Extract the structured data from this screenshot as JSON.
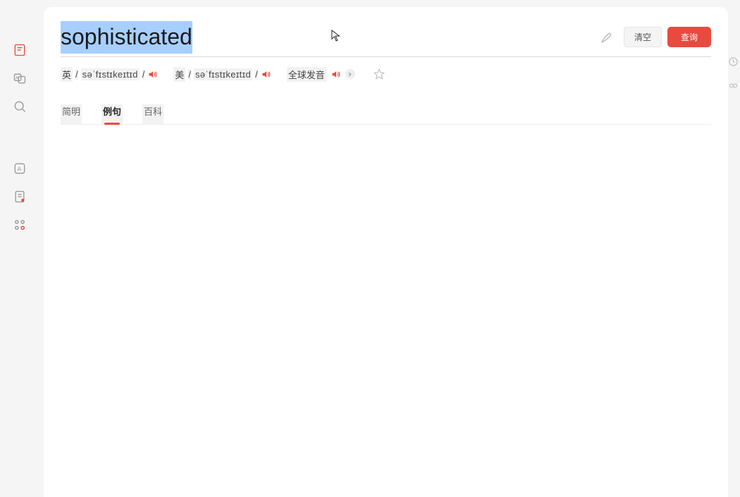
{
  "search": {
    "word": "sophisticated",
    "clear_label": "清空",
    "query_label": "查询"
  },
  "phonetics": {
    "uk_label": "英",
    "uk_ipa": "səˈfɪstɪkeɪtɪd",
    "us_label": "美",
    "us_ipa": "səˈfɪstɪkeɪtɪd",
    "global_label": "全球发音"
  },
  "tabs": [
    {
      "label": "简明"
    },
    {
      "label": "例句"
    },
    {
      "label": "百科"
    }
  ],
  "sidebar": {
    "items": [
      "dictionary",
      "translate",
      "search",
      "reader",
      "note",
      "apps"
    ]
  }
}
